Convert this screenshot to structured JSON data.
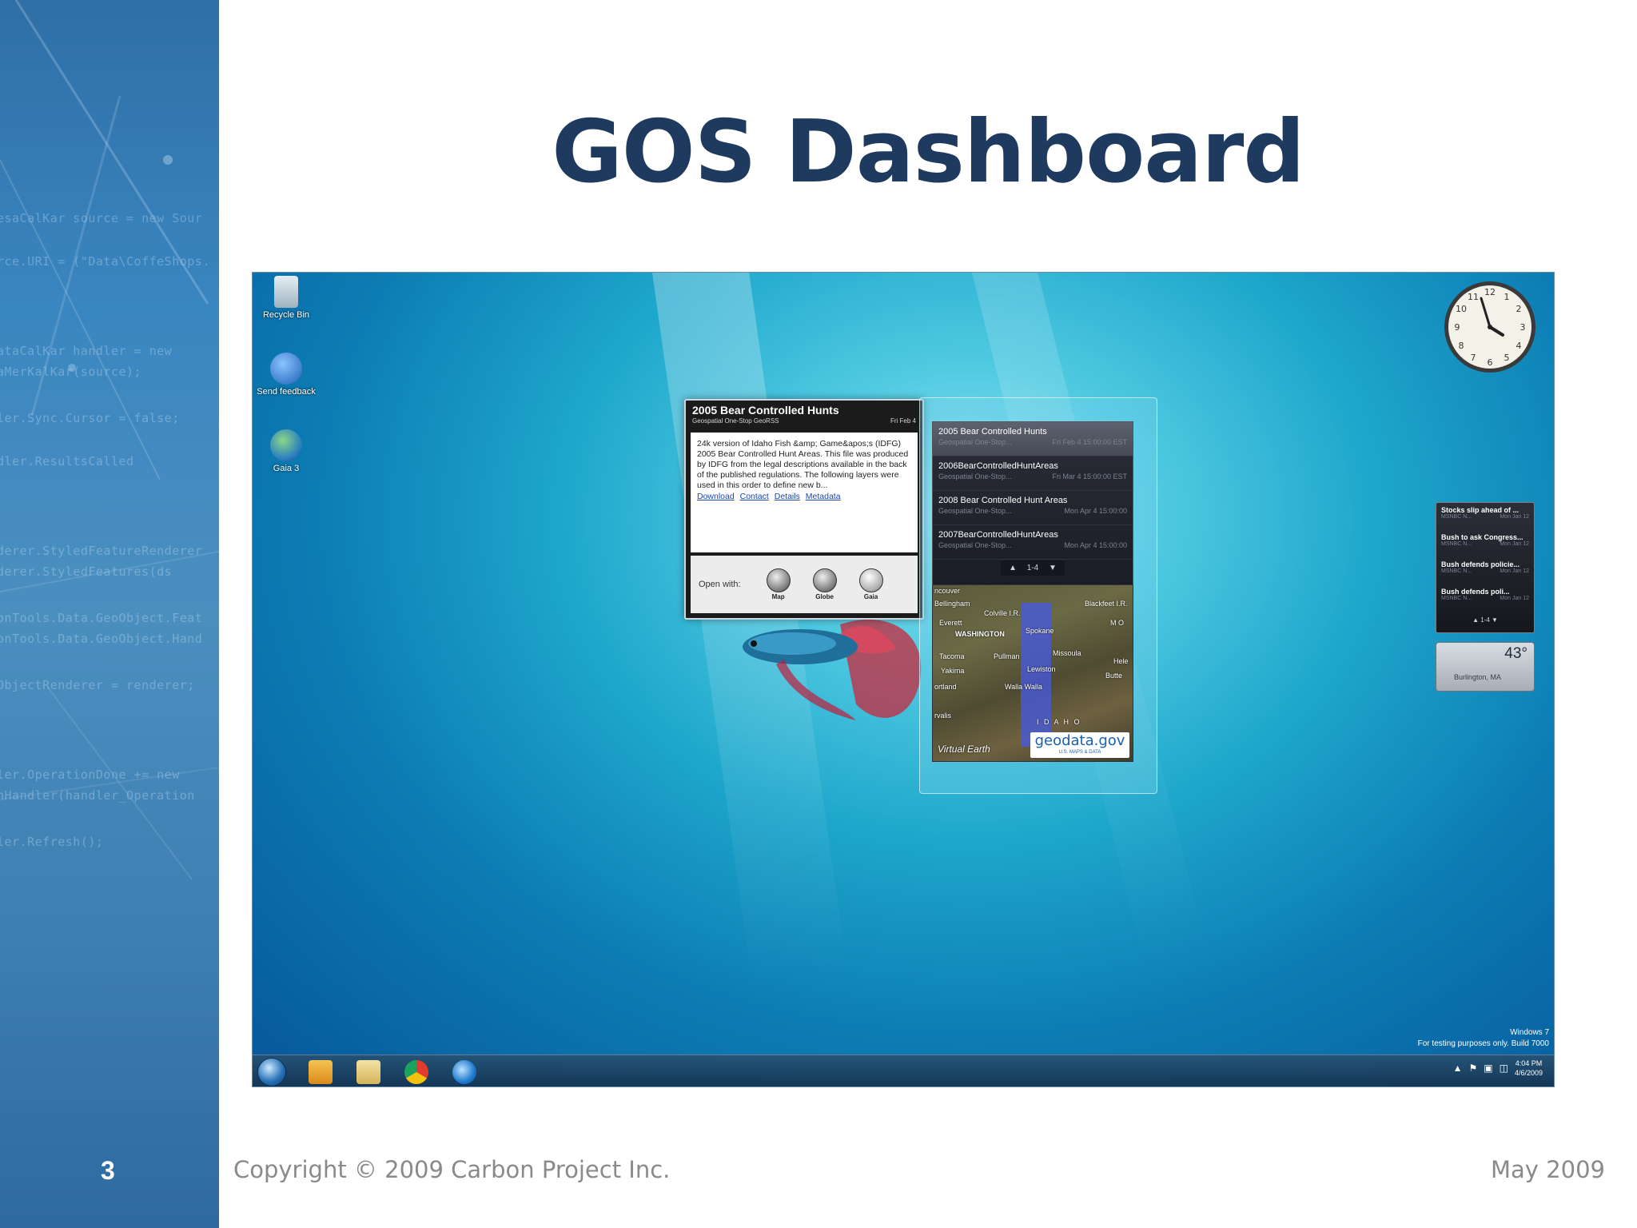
{
  "slide": {
    "title": "GOS Dashboard",
    "number": "3",
    "copyright": "Copyright © 2009 Carbon Project Inc.",
    "date": "May 2009"
  },
  "left_band": {
    "code_lines": [
      "esaCalKar source = new Sour",
      "rce.URI = (\"Data\\CoffeShops.",
      "ataCalKar handler = new",
      "aMerKalKar(source);",
      "ler.Sync.Cursor = false;",
      "dler.ResultsCalled",
      "derer.StyledFeatureRenderer",
      "derer.StyledFeatures(ds",
      "onTools.Data.GeoObject.Feat",
      "onTools.Data.GeoObject.Hand",
      "ObjectRenderer = renderer;",
      "ler.OperationDone += new",
      "nHandler(handler_Operation",
      "ler.Refresh();"
    ]
  },
  "desktop": {
    "icons": [
      {
        "label": "Recycle Bin"
      },
      {
        "label": "Send feedback"
      },
      {
        "label": "Gaia 3"
      }
    ],
    "detail_card": {
      "title": "2005 Bear Controlled Hunts",
      "source": "Geospatial One-Stop GeoRSS",
      "date": "Fri Feb 4",
      "description": "24k version of Idaho Fish &amp; Game&apos;s (IDFG) 2005 Bear Controlled Hunt Areas. This file was produced by IDFG from the legal descriptions available in the back of the published regulations. The following layers were used in this order to define new b...",
      "links": [
        "Download",
        "Contact",
        "Details",
        "Metadata"
      ],
      "open_with_label": "Open with:",
      "open_with": [
        {
          "label": "Map"
        },
        {
          "label": "Globe"
        },
        {
          "label": "Gaia"
        }
      ]
    },
    "feed_list": {
      "items": [
        {
          "title": "2005 Bear Controlled Hunts",
          "source": "Geospatial One-Stop...",
          "date": "Fri Feb 4 15:00:00 EST"
        },
        {
          "title": "2006BearControlledHuntAreas",
          "source": "Geospatial One-Stop...",
          "date": "Fri Mar 4 15:00:00 EST"
        },
        {
          "title": "2008 Bear Controlled Hunt Areas",
          "source": "Geospatial One-Stop...",
          "date": "Mon Apr 4 15:00:00"
        },
        {
          "title": "2007BearControlledHuntAreas",
          "source": "Geospatial One-Stop...",
          "date": "Mon Apr 4 15:00:00"
        }
      ],
      "pager": "1-4",
      "map": {
        "labels": [
          "ncouver",
          "Bellingham",
          "Colville I.R.",
          "Blackfeet I.R.",
          "Everett",
          "WASHINGTON",
          "Spokane",
          "M O",
          "Tacoma",
          "Pullman",
          "Missoula",
          "Hele",
          "Yakima",
          "Lewiston",
          "Butte",
          "ortland",
          "Walla Walla",
          "I D A H O",
          "rvalis"
        ],
        "brand": "Virtual Earth",
        "logo": "geodata.gov",
        "logo_sub": "U.S. MAPS & DATA"
      }
    },
    "news": {
      "items": [
        {
          "title": "Stocks slip ahead of ...",
          "source": "MSNBC N...",
          "date": "Mon Jan 12"
        },
        {
          "title": "Bush to ask Congress...",
          "source": "MSNBC N...",
          "date": "Mon Jan 12"
        },
        {
          "title": "Bush defends policie...",
          "source": "MSNBC N...",
          "date": "Mon Jan 12"
        },
        {
          "title": "Bush defends poli...",
          "source": "MSNBC N...",
          "date": "Mon Jan 12"
        }
      ],
      "pager": "1-4"
    },
    "weather": {
      "temperature": "43°",
      "location": "Burlington, MA"
    },
    "watermark": {
      "line1": "Windows 7",
      "line2": "For testing purposes only. Build 7000"
    },
    "taskbar": {
      "time": "4:04 PM",
      "date": "4/6/2009",
      "apps": [
        "media-player",
        "explorer",
        "chrome",
        "internet-explorer"
      ]
    }
  }
}
